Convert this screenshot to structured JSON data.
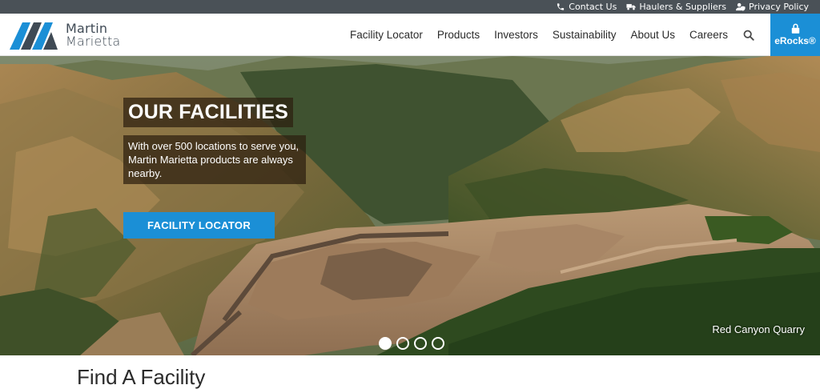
{
  "utility": {
    "links": [
      {
        "label": "Contact Us",
        "icon": "phone-icon"
      },
      {
        "label": "Haulers & Suppliers",
        "icon": "truck-icon"
      },
      {
        "label": "Privacy Policy",
        "icon": "user-shield-icon"
      }
    ]
  },
  "header": {
    "logo": {
      "line1": "Martin",
      "line2": "Marietta"
    },
    "nav": [
      "Facility Locator",
      "Products",
      "Investors",
      "Sustainability",
      "About Us",
      "Careers"
    ],
    "search_icon": "search-icon",
    "erocks": {
      "label": "eRocks®",
      "icon": "lock-icon"
    }
  },
  "hero": {
    "title": "OUR FACILITIES",
    "description": "With over 500 locations to serve you, Martin Marietta products are always nearby.",
    "cta": "FACILITY LOCATOR",
    "caption": "Red Canyon Quarry",
    "slides": 4,
    "active_slide": 1
  },
  "section": {
    "title": "Find A Facility"
  },
  "colors": {
    "brand_blue": "#1b8fd6",
    "utility_bar": "#4a5157",
    "text_dark": "#2b2b2b"
  }
}
